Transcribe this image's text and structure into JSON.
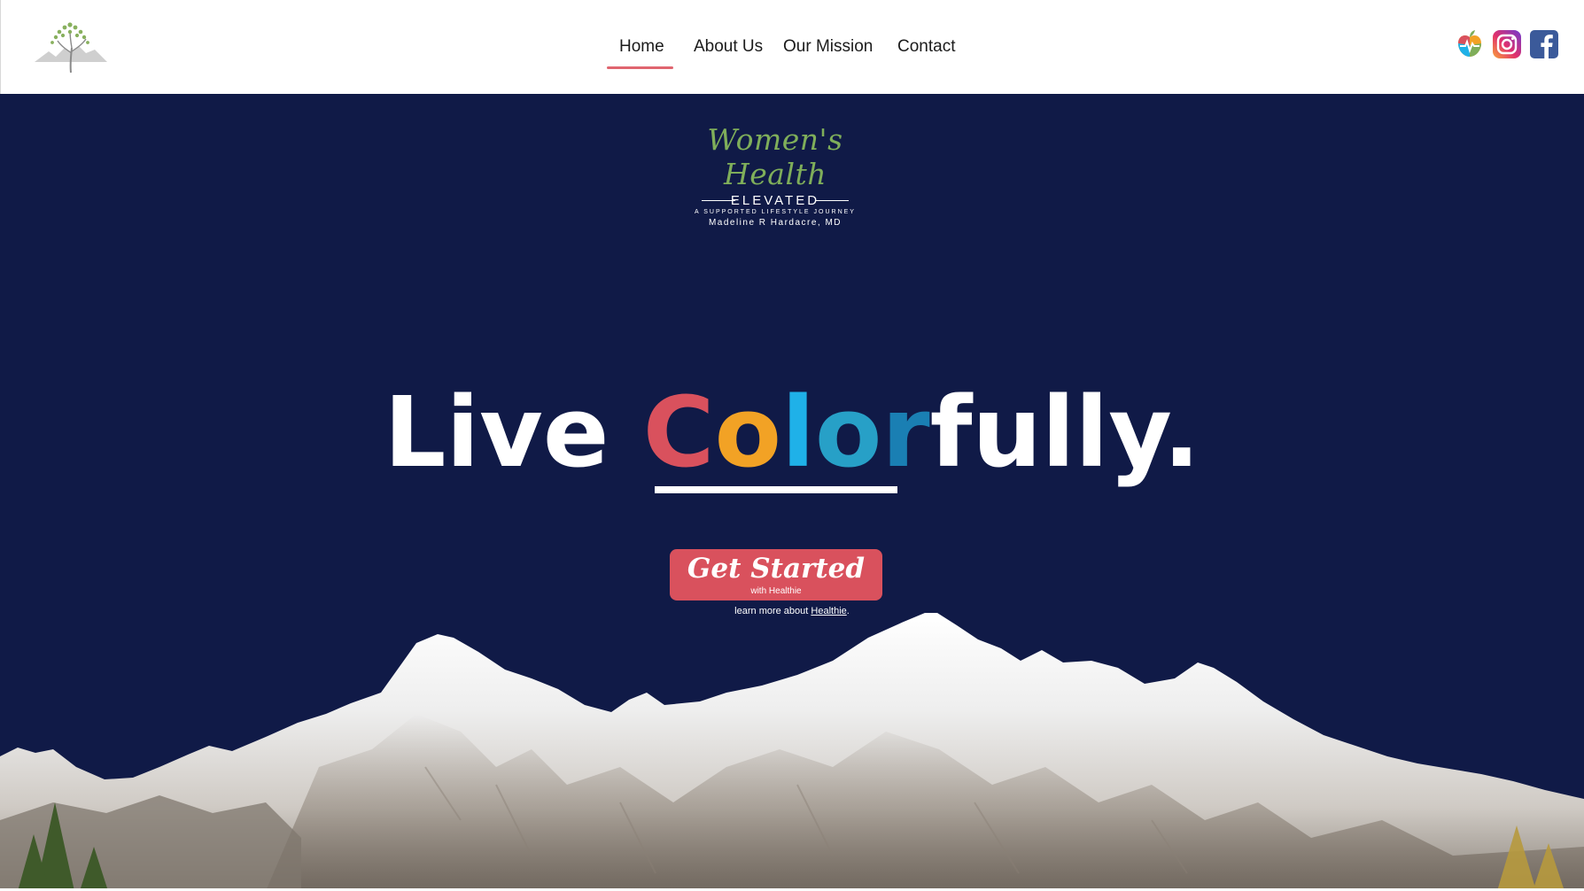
{
  "nav": {
    "items": [
      {
        "label": "Home",
        "active": true
      },
      {
        "label": "About Us",
        "active": false
      },
      {
        "label": "Our Mission",
        "active": false
      },
      {
        "label": "Contact",
        "active": false
      }
    ]
  },
  "social": {
    "icons": [
      "healthie-apple-icon",
      "instagram-icon",
      "facebook-icon"
    ]
  },
  "brand": {
    "script": "Women's Health",
    "elevated": "ELEVATED",
    "tagline": "A SUPPORTED LIFESTYLE JOURNEY",
    "name": "Madeline R Hardacre, MD"
  },
  "hero": {
    "headline_before": "Live ",
    "headline_color_word": [
      "C",
      "o",
      "l",
      "o",
      "r"
    ],
    "headline_after": "fully.",
    "cta_title": "Get Started",
    "cta_sub": "with Healthie",
    "learn_prefix": "learn more about ",
    "learn_link": "Healthie",
    "learn_suffix": "."
  },
  "colors": {
    "navy": "#101a47",
    "accent_red": "#d9515d",
    "accent_orange": "#f2a225",
    "accent_blue": "#1fb1e8",
    "brand_green": "#7fae5a"
  }
}
